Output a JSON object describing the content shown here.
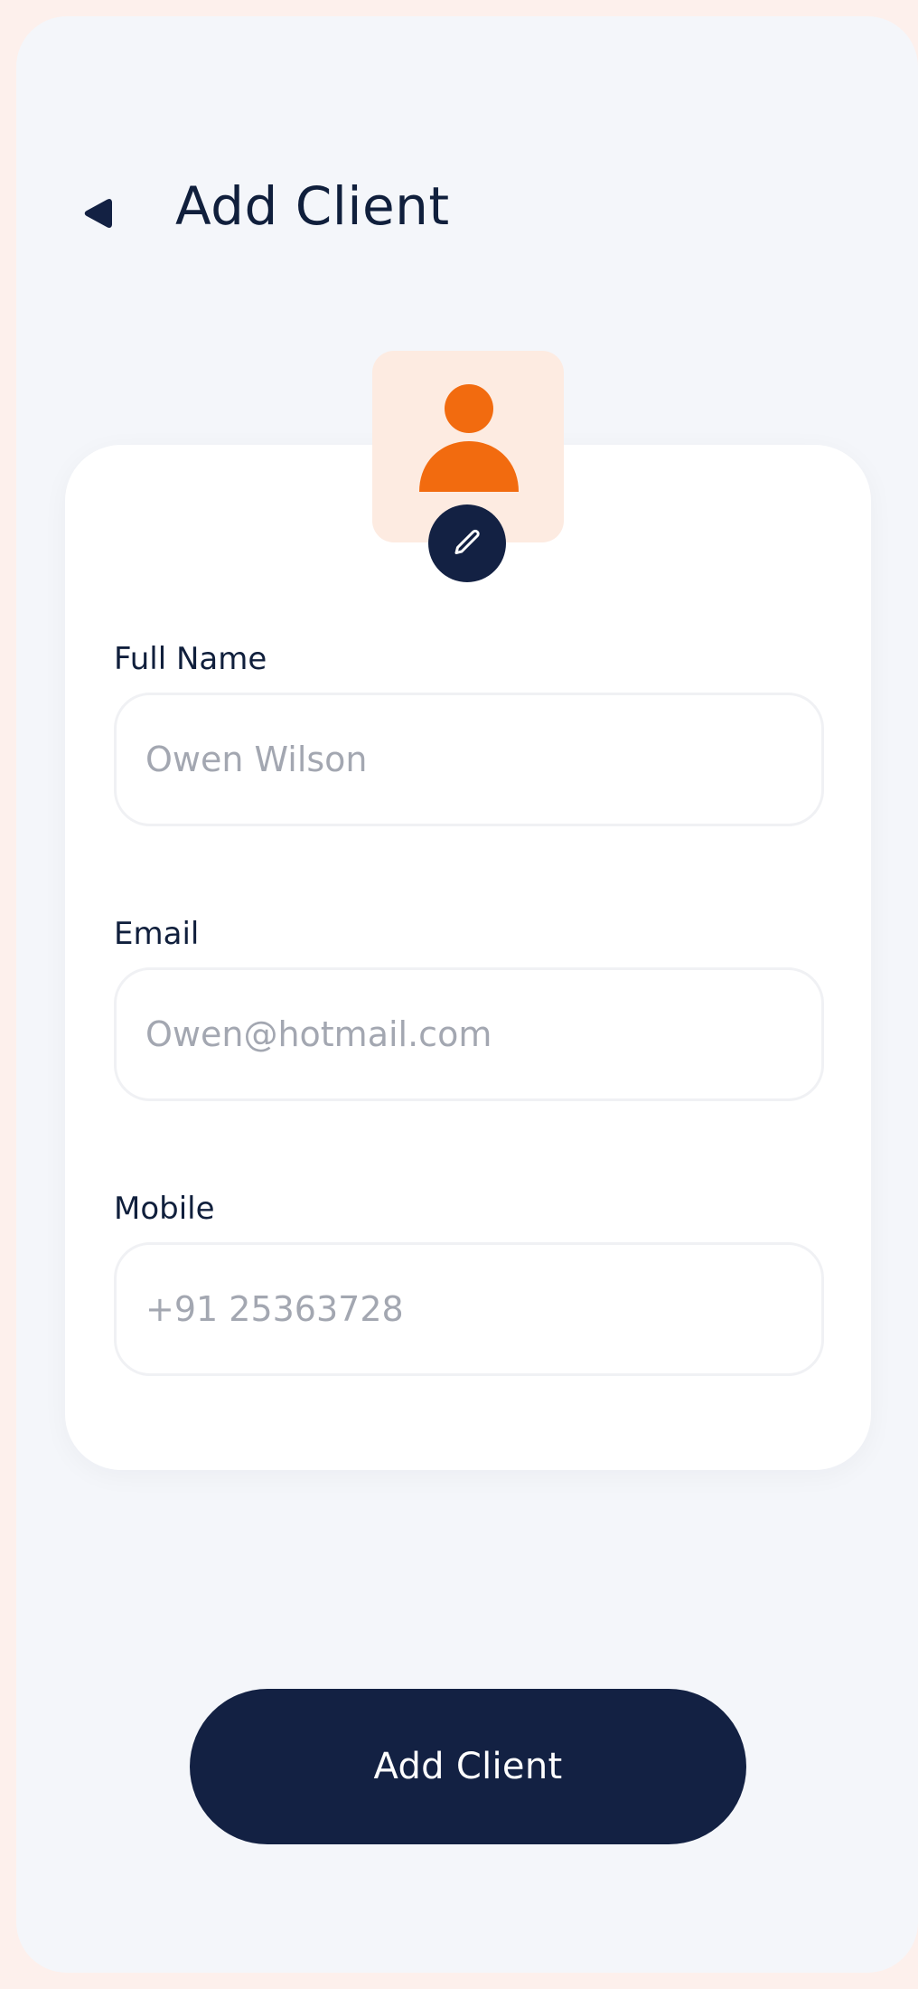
{
  "header": {
    "back_icon": "back-arrow-icon",
    "title": "Add Client"
  },
  "avatar": {
    "icon": "user-icon",
    "edit_icon": "pencil-icon",
    "accent_color": "#f26b0f",
    "background_color": "#fdebe1"
  },
  "form": {
    "full_name": {
      "label": "Full Name",
      "placeholder": "Owen Wilson",
      "value": ""
    },
    "email": {
      "label": "Email",
      "placeholder": "Owen@hotmail.com",
      "value": ""
    },
    "mobile": {
      "label": "Mobile",
      "placeholder": "+91 25363728",
      "value": ""
    }
  },
  "submit_label": "Add Client",
  "colors": {
    "primary": "#132143",
    "text": "#101f3c",
    "page_background": "#f4f6fa",
    "outer_background": "#fdf0ec",
    "placeholder": "#a3a7b1"
  }
}
